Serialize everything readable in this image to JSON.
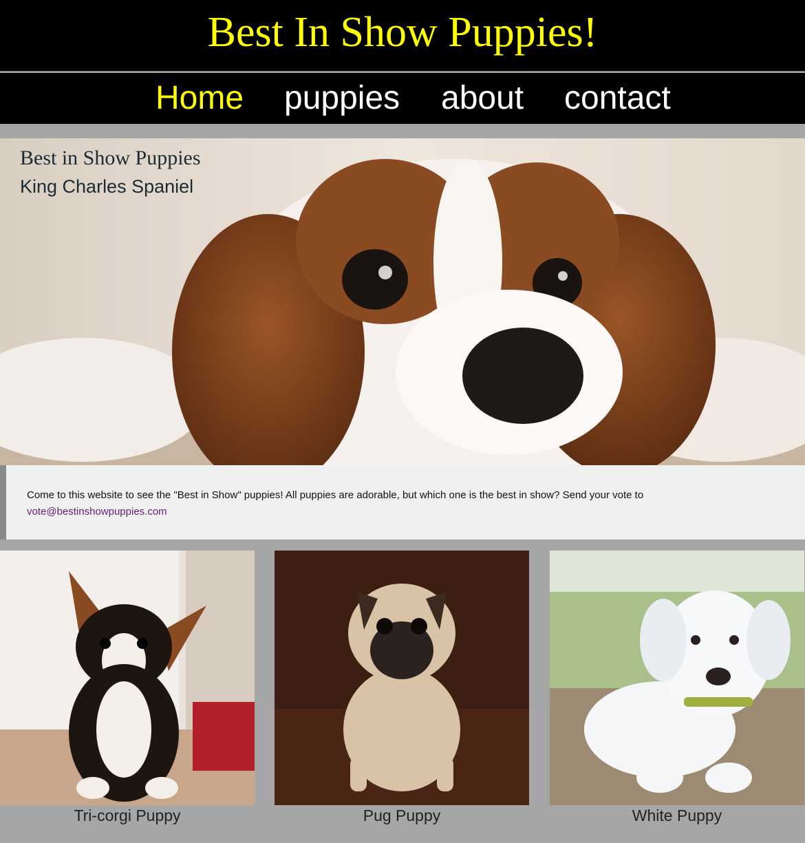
{
  "site": {
    "title": "Best In Show Puppies!"
  },
  "nav": {
    "items": [
      {
        "label": "Home",
        "active": true
      },
      {
        "label": "puppies",
        "active": false
      },
      {
        "label": "about",
        "active": false
      },
      {
        "label": "contact",
        "active": false
      }
    ]
  },
  "hero": {
    "title": "Best in Show Puppies",
    "subtitle": "King Charles Spaniel"
  },
  "intro": {
    "text": "Come to this website to see the \"Best in Show\" puppies! All puppies are adorable, but which one is the best in show? Send your vote to",
    "email": "vote@bestinshowpuppies.com"
  },
  "gallery": [
    {
      "caption": "Tri-corgi Puppy"
    },
    {
      "caption": "Pug Puppy"
    },
    {
      "caption": "White Puppy"
    }
  ],
  "colors": {
    "accent": "#ffff00",
    "header_bg": "#000000",
    "page_bg": "#a6a6a6",
    "link": "#6a1b7a"
  }
}
